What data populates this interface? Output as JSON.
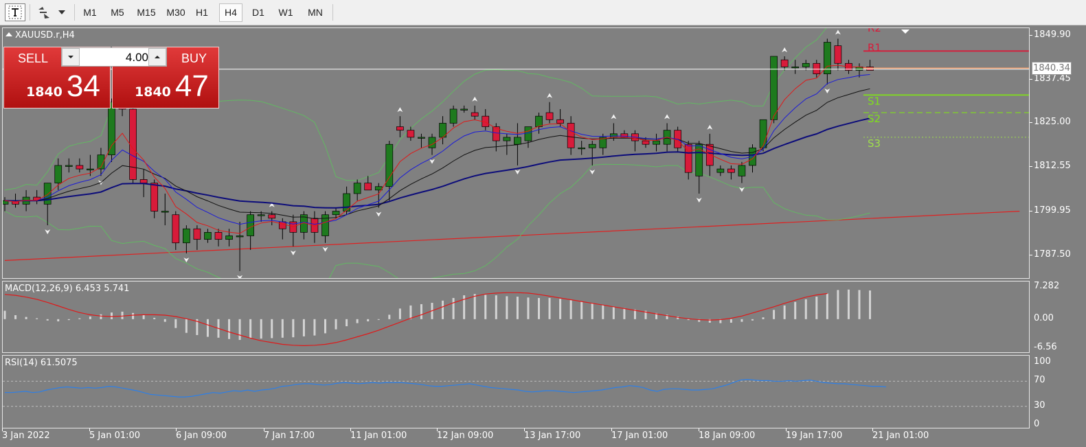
{
  "toolbar": {
    "icons": [
      "text-tool-icon",
      "objects-tool-icon",
      "dropdown-arrow-icon"
    ],
    "timeframes": [
      "M1",
      "M5",
      "M15",
      "M30",
      "H1",
      "H4",
      "D1",
      "W1",
      "MN"
    ],
    "active_timeframe": "H4"
  },
  "symbol_title": "XAUUSD.r,H4",
  "one_click": {
    "sell_label": "SELL",
    "buy_label": "BUY",
    "lot_value": "4.00",
    "sell_price_small": "1840",
    "sell_price_big": "34",
    "buy_price_small": "1840",
    "buy_price_big": "47"
  },
  "price_axis": [
    "1849.90",
    "1837.45",
    "1825.00",
    "1812.55",
    "1799.95",
    "1787.50"
  ],
  "current_price_label": "1840.34",
  "pivot_labels": [
    "R2",
    "R1",
    "S1",
    "S2",
    "S3"
  ],
  "macd": {
    "title": "MACD(12,26,9) 6.453 5.741",
    "axis": [
      "7.282",
      "0.00",
      "-6.56"
    ]
  },
  "rsi": {
    "title": "RSI(14) 61.5075",
    "axis": [
      "100",
      "70",
      "30",
      "0"
    ]
  },
  "time_axis": [
    "3 Jan 2022",
    "5 Jan 01:00",
    "6 Jan 09:00",
    "7 Jan 17:00",
    "11 Jan 01:00",
    "12 Jan 09:00",
    "13 Jan 17:00",
    "17 Jan 01:00",
    "18 Jan 09:00",
    "19 Jan 17:00",
    "21 Jan 01:00"
  ],
  "colors": {
    "background": "#808080",
    "bull_candle": "#1e7a1e",
    "bear_candle": "#d81b3a",
    "bands": "#62b862",
    "ma_fast": "#e01818",
    "ma_mid": "#1a1ad8",
    "ma_slow": "#101010",
    "ma_long": "#0c0c7a",
    "trendline": "#e02020",
    "macd_signal": "#e01818",
    "macd_hist": "#d4d4d4",
    "rsi_line": "#2c7fe8"
  },
  "chart_data": [
    {
      "type": "candlestick",
      "symbol": "XAUUSD.r",
      "timeframe": "H4",
      "ylim": [
        1781.0,
        1852.0
      ],
      "x_labels": [
        "3 Jan 2022",
        "5 Jan 01:00",
        "6 Jan 09:00",
        "7 Jan 17:00",
        "11 Jan 01:00",
        "12 Jan 09:00",
        "13 Jan 17:00",
        "17 Jan 01:00",
        "18 Jan 09:00",
        "19 Jan 17:00",
        "21 Jan 01:00"
      ],
      "candles": [
        [
          1802,
          1804,
          1800,
          1803
        ],
        [
          1803,
          1805,
          1801,
          1802
        ],
        [
          1802,
          1806,
          1800,
          1804
        ],
        [
          1804,
          1806,
          1802,
          1803
        ],
        [
          1802,
          1808,
          1796,
          1808
        ],
        [
          1808,
          1815,
          1806,
          1813
        ],
        [
          1813,
          1815,
          1811,
          1813
        ],
        [
          1813,
          1815,
          1811,
          1812
        ],
        [
          1812,
          1816,
          1810,
          1812
        ],
        [
          1812,
          1818,
          1810,
          1816
        ],
        [
          1816,
          1832,
          1814,
          1831
        ],
        [
          1831,
          1834,
          1827,
          1829
        ],
        [
          1829,
          1831,
          1808,
          1809
        ],
        [
          1809,
          1812,
          1804,
          1808
        ],
        [
          1808,
          1809,
          1798,
          1800
        ],
        [
          1800,
          1805,
          1796,
          1800
        ],
        [
          1799,
          1800,
          1789,
          1791
        ],
        [
          1791,
          1796,
          1788,
          1795
        ],
        [
          1795,
          1796,
          1789,
          1792
        ],
        [
          1792,
          1795,
          1791,
          1794
        ],
        [
          1794,
          1795,
          1790,
          1792
        ],
        [
          1792,
          1795,
          1790,
          1793
        ],
        [
          1793,
          1797,
          1783,
          1793
        ],
        [
          1793,
          1800,
          1789,
          1799
        ],
        [
          1799,
          1800,
          1797,
          1799
        ],
        [
          1799,
          1800,
          1796,
          1798
        ],
        [
          1797,
          1798,
          1792,
          1795
        ],
        [
          1797,
          1799,
          1790,
          1794
        ],
        [
          1794,
          1800,
          1792,
          1799
        ],
        [
          1798,
          1800,
          1791,
          1794
        ],
        [
          1793,
          1800,
          1791,
          1799
        ],
        [
          1799,
          1801,
          1798,
          1800
        ],
        [
          1800,
          1807,
          1799,
          1805
        ],
        [
          1805,
          1809,
          1803,
          1808
        ],
        [
          1808,
          1810,
          1806,
          1806
        ],
        [
          1806,
          1808,
          1801,
          1807
        ],
        [
          1807,
          1820,
          1803,
          1819
        ],
        [
          1824,
          1827,
          1821,
          1823
        ],
        [
          1823,
          1824,
          1820,
          1821
        ],
        [
          1821,
          1822,
          1818,
          1821
        ],
        [
          1818,
          1822,
          1816,
          1821
        ],
        [
          1821,
          1827,
          1819,
          1825
        ],
        [
          1825,
          1830,
          1824,
          1829
        ],
        [
          1829,
          1830,
          1828,
          1829
        ],
        [
          1828,
          1830,
          1826,
          1827
        ],
        [
          1827,
          1829,
          1823,
          1824
        ],
        [
          1824,
          1825,
          1817,
          1820
        ],
        [
          1820,
          1822,
          1816,
          1821
        ],
        [
          1819,
          1825,
          1813,
          1821
        ],
        [
          1820,
          1823,
          1818,
          1824
        ],
        [
          1824,
          1828,
          1822,
          1827
        ],
        [
          1828,
          1831,
          1825,
          1826
        ],
        [
          1826,
          1829,
          1824,
          1825
        ],
        [
          1825,
          1827,
          1816,
          1818
        ],
        [
          1818,
          1820,
          1816,
          1818
        ],
        [
          1818,
          1820,
          1813,
          1819
        ],
        [
          1818,
          1822,
          1816,
          1821
        ],
        [
          1821,
          1825,
          1820,
          1822
        ],
        [
          1822,
          1823,
          1821,
          1821
        ],
        [
          1822,
          1823,
          1817,
          1820
        ],
        [
          1820,
          1821,
          1818,
          1819
        ],
        [
          1819,
          1822,
          1817,
          1820
        ],
        [
          1819,
          1825,
          1817,
          1823
        ],
        [
          1823,
          1824,
          1817,
          1818
        ],
        [
          1819,
          1820,
          1809,
          1811
        ],
        [
          1810,
          1820,
          1805,
          1819
        ],
        [
          1819,
          1822,
          1810,
          1813
        ],
        [
          1811,
          1813,
          1810,
          1812
        ],
        [
          1812,
          1813,
          1809,
          1811
        ],
        [
          1810,
          1814,
          1808,
          1813
        ],
        [
          1813,
          1819,
          1811,
          1818
        ],
        [
          1818,
          1826,
          1817,
          1826
        ],
        [
          1826,
          1844,
          1825,
          1844
        ],
        [
          1843,
          1844,
          1840,
          1841
        ],
        [
          1841,
          1843,
          1839,
          1841
        ],
        [
          1841,
          1843,
          1840,
          1842
        ],
        [
          1842,
          1843,
          1838,
          1839
        ],
        [
          1839,
          1849,
          1836,
          1848
        ],
        [
          1847,
          1849,
          1840,
          1842
        ],
        [
          1842,
          1843,
          1839,
          1840
        ],
        [
          1840,
          1842,
          1838,
          1841
        ],
        [
          1841,
          1843,
          1840,
          1840
        ]
      ],
      "trendline": [
        [
          0,
          1786.0
        ],
        [
          95,
          1800.0
        ]
      ],
      "pivots": {
        "R2": 1851.0,
        "R1": 1845.5,
        "S1": 1833.0,
        "S2": 1828.0,
        "S3": 1821.0
      },
      "current_price": 1840.34
    },
    {
      "type": "bar",
      "name": "MACD(12,26,9)",
      "ylim": [
        -6.56,
        7.282
      ],
      "values": [
        1.9,
        0.9,
        0.5,
        0.2,
        -0.3,
        -0.5,
        -0.2,
        0.2,
        0.6,
        1.1,
        1.5,
        1.7,
        1.4,
        0.9,
        0.3,
        -0.6,
        -2.0,
        -3.1,
        -3.6,
        -4.0,
        -4.2,
        -4.5,
        -4.7,
        -4.4,
        -4.4,
        -4.3,
        -4.2,
        -4.1,
        -3.9,
        -3.7,
        -3.2,
        -2.3,
        -1.6,
        -0.9,
        -0.5,
        -0.1,
        1.0,
        2.4,
        3.1,
        3.4,
        3.7,
        4.2,
        4.8,
        5.4,
        5.7,
        5.5,
        5.4,
        5.2,
        5.1,
        4.9,
        4.8,
        4.8,
        4.6,
        4.3,
        4.0,
        3.6,
        3.2,
        2.8,
        2.5,
        2.2,
        1.9,
        1.4,
        1.0,
        0.6,
        -0.2,
        -0.6,
        -0.8,
        -0.9,
        -0.8,
        -0.6,
        -0.3,
        0.4,
        2.1,
        3.1,
        3.9,
        4.5,
        5.1,
        5.8,
        6.6,
        6.7,
        6.6,
        6.5
      ],
      "signal": [
        5.6,
        5.4,
        5.0,
        4.5,
        3.8,
        3.0,
        2.2,
        1.5,
        1.0,
        0.7,
        0.6,
        0.7,
        0.9,
        1.0,
        1.0,
        0.9,
        0.6,
        0.1,
        -0.5,
        -1.3,
        -2.1,
        -2.9,
        -3.6,
        -4.3,
        -4.9,
        -5.3,
        -5.7,
        -5.9,
        -6.0,
        -5.9,
        -5.7,
        -5.3,
        -4.7,
        -4.0,
        -3.3,
        -2.5,
        -1.6,
        -0.7,
        0.2,
        1.0,
        1.9,
        2.8,
        3.7,
        4.5,
        5.2,
        5.7,
        5.9,
        6.0,
        6.0,
        5.9,
        5.6,
        5.2,
        4.8,
        4.4,
        4.0,
        3.6,
        3.2,
        2.8,
        2.4,
        2.0,
        1.6,
        1.2,
        0.8,
        0.4,
        0.1,
        -0.1,
        -0.2,
        -0.1,
        0.2,
        0.7,
        1.4,
        2.1,
        2.8,
        3.6,
        4.3,
        5.0,
        5.5,
        5.8
      ],
      "title": "MACD(12,26,9) 6.453 5.741"
    },
    {
      "type": "line",
      "name": "RSI(14)",
      "ylim": [
        0,
        100
      ],
      "levels": [
        70,
        30
      ],
      "values": [
        52,
        52,
        53,
        54,
        52,
        53,
        56,
        58,
        60,
        61,
        60,
        59,
        60,
        59,
        60,
        62,
        61,
        59,
        57,
        55,
        52,
        49,
        48,
        47,
        46,
        45,
        45,
        46,
        48,
        50,
        52,
        51,
        53,
        55,
        54,
        56,
        54,
        56,
        57,
        59,
        62,
        63,
        65,
        66,
        66,
        65,
        64,
        65,
        67,
        68,
        67,
        66,
        67,
        68,
        67,
        68,
        68,
        68,
        67,
        66,
        65,
        63,
        62,
        62,
        63,
        64,
        65,
        66,
        64,
        62,
        60,
        59,
        58,
        57,
        56,
        54,
        53,
        54,
        55,
        55,
        54,
        53,
        52,
        53,
        54,
        55,
        56,
        58,
        60,
        61,
        63,
        62,
        60,
        56,
        54,
        57,
        58,
        58,
        57,
        56,
        56,
        57,
        58,
        61,
        64,
        68,
        72,
        73,
        72,
        71,
        71,
        70,
        70,
        71,
        70,
        71,
        72,
        70,
        68,
        67,
        66,
        66,
        65,
        64,
        63,
        62,
        62,
        61
      ]
    }
  ]
}
